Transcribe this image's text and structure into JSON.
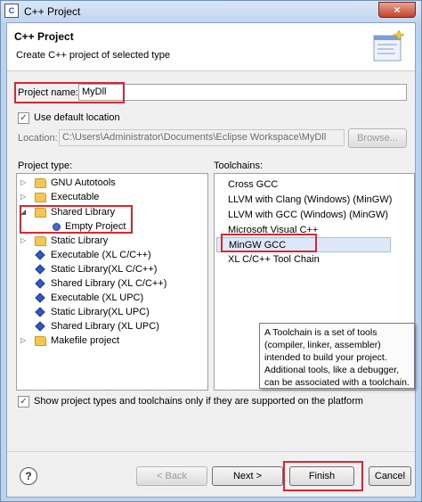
{
  "window": {
    "title": "C++ Project",
    "close_glyph": "×"
  },
  "header": {
    "title": "C++ Project",
    "description": "Create C++ project of selected type"
  },
  "project_name": {
    "label": "Project name:",
    "value": "MyDll"
  },
  "default_location": {
    "label": "Use default location",
    "checked": true,
    "check_glyph": "✓"
  },
  "location": {
    "label": "Location:",
    "value": "C:\\Users\\Administrator\\Documents\\Eclipse Workspace\\MyDll",
    "browse_label": "Browse..."
  },
  "project_type": {
    "label": "Project type:",
    "items": [
      {
        "label": "GNU Autotools",
        "icon": "folder-icon",
        "expanded": false
      },
      {
        "label": "Executable",
        "icon": "folder-icon",
        "expanded": false
      },
      {
        "label": "Shared Library",
        "icon": "folder-icon",
        "expanded": true
      },
      {
        "label": "Empty Project",
        "icon": "radio-icon",
        "child": true
      },
      {
        "label": "Static Library",
        "icon": "folder-icon",
        "expanded": false
      },
      {
        "label": "Executable (XL C/C++)",
        "icon": "diamond-icon"
      },
      {
        "label": "Static Library(XL C/C++)",
        "icon": "diamond-icon"
      },
      {
        "label": "Shared Library (XL C/C++)",
        "icon": "diamond-icon"
      },
      {
        "label": "Executable (XL UPC)",
        "icon": "diamond-icon"
      },
      {
        "label": "Static Library(XL UPC)",
        "icon": "diamond-icon"
      },
      {
        "label": "Shared Library (XL UPC)",
        "icon": "diamond-icon"
      },
      {
        "label": "Makefile project",
        "icon": "folder-icon",
        "expanded": false
      }
    ]
  },
  "toolchains": {
    "label": "Toolchains:",
    "items": [
      {
        "label": "Cross GCC"
      },
      {
        "label": "LLVM with Clang (Windows) (MinGW)"
      },
      {
        "label": "LLVM with GCC (Windows) (MinGW)"
      },
      {
        "label": "Microsoft Visual C++"
      },
      {
        "label": "MinGW GCC",
        "selected": true
      },
      {
        "label": "XL C/C++ Tool Chain"
      }
    ],
    "tooltip": [
      "A Toolchain is a set of tools",
      "(compiler, linker, assembler)",
      "intended to build your project.",
      "Additional tools, like a debugger,",
      "can be associated with a toolchain."
    ]
  },
  "filter": {
    "label": "Show project types and toolchains only if they are supported on the platform",
    "checked": true,
    "check_glyph": "✓"
  },
  "buttons": {
    "help_glyph": "?",
    "back": "< Back",
    "next": "Next >",
    "finish": "Finish",
    "cancel": "Cancel"
  },
  "colors": {
    "annotation": "#d9262f",
    "selection": "#dde9f8"
  }
}
